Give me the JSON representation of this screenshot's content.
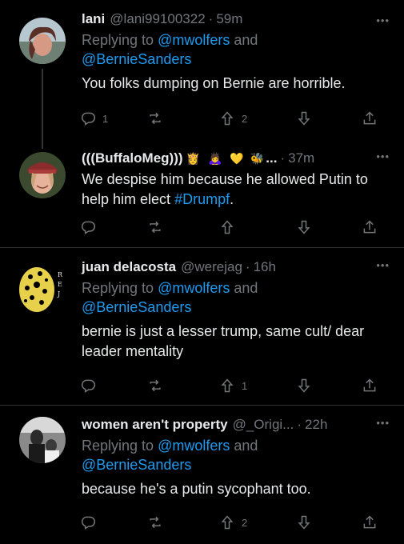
{
  "tweets": [
    {
      "name": "lani",
      "handle": "@lani99100322",
      "sep": "·",
      "time": "59m",
      "reply_prefix": "Replying to",
      "mentions": [
        "@mwolfers",
        "@BernieSanders"
      ],
      "and": "and",
      "text": "You folks dumping on Bernie are horrible.",
      "counts": {
        "reply": "1",
        "retweet": "",
        "like": "2"
      }
    },
    {
      "name": "(((BuffaloMeg)))",
      "emojis": [
        "👸",
        "🙇‍♀️",
        "💛",
        "🐝"
      ],
      "ellipsis": "...",
      "sep": "·",
      "time": "37m",
      "text_pre": "We despise him because he allowed Putin to help him elect ",
      "hashtag": "#Drumpf",
      "text_post": ".",
      "counts": {
        "reply": "",
        "retweet": "",
        "like": ""
      }
    },
    {
      "name": "juan delacosta",
      "handle": "@werejag",
      "sep": "·",
      "time": "16h",
      "reply_prefix": "Replying to",
      "mentions": [
        "@mwolfers",
        "@BernieSanders"
      ],
      "and": "and",
      "text": "bernie is just a lesser trump, same cult/ dear leader mentality",
      "counts": {
        "reply": "",
        "retweet": "",
        "like": "1"
      }
    },
    {
      "name": "women aren't property",
      "handle": "@_Origi...",
      "sep": "·",
      "time": "22h",
      "reply_prefix": "Replying to",
      "mentions": [
        "@mwolfers",
        "@BernieSanders"
      ],
      "and": "and",
      "text": "because he's a putin sycophant too.",
      "counts": {
        "reply": "",
        "retweet": "",
        "like": "2"
      }
    }
  ],
  "more_label": "•••",
  "colors": {
    "background": "#000000",
    "text": "#e7e9ea",
    "muted": "#71767b",
    "link": "#1d9bf0",
    "divider": "#2f3336"
  }
}
